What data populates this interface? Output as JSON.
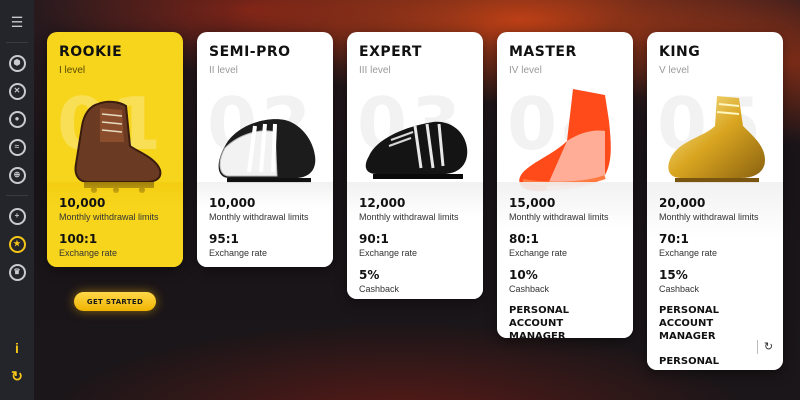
{
  "sidebar": {
    "items": [
      {
        "icon": "menu-icon"
      },
      {
        "icon": "soccer-ball-icon"
      },
      {
        "icon": "basketball-icon"
      },
      {
        "icon": "film-reel-icon"
      },
      {
        "icon": "wifi-icon"
      },
      {
        "icon": "globe-icon"
      },
      {
        "icon": "crosshair-icon"
      },
      {
        "icon": "loyalty-star-icon",
        "active": true
      },
      {
        "icon": "trophy-icon"
      }
    ],
    "bottom": [
      {
        "icon": "info-icon",
        "glyph": "i"
      },
      {
        "icon": "support-icon",
        "glyph": "↻"
      }
    ]
  },
  "colors": {
    "accent": "#f5c518",
    "card_yellow": "#f7d51d"
  },
  "levels": [
    {
      "title": "ROOKIE",
      "level": "I level",
      "big": "01",
      "limit": "10,000",
      "limit_label": "Monthly withdrawal limits",
      "rate": "100:1",
      "rate_label": "Exchange rate",
      "boot": "brown-vintage-boot-icon"
    },
    {
      "title": "SEMI-PRO",
      "level": "II level",
      "big": "02",
      "limit": "10,000",
      "limit_label": "Monthly withdrawal limits",
      "rate": "95:1",
      "rate_label": "Exchange rate",
      "boot": "black-white-boot-icon"
    },
    {
      "title": "EXPERT",
      "level": "III level",
      "big": "03",
      "limit": "12,000",
      "limit_label": "Monthly withdrawal limits",
      "rate": "90:1",
      "rate_label": "Exchange rate",
      "cashback": "5%",
      "cashback_label": "Cashback",
      "boot": "black-classic-boot-icon"
    },
    {
      "title": "MASTER",
      "level": "IV level",
      "big": "04",
      "limit": "15,000",
      "limit_label": "Monthly withdrawal limits",
      "rate": "80:1",
      "rate_label": "Exchange rate",
      "cashback": "10%",
      "cashback_label": "Cashback",
      "perk1": "PERSONAL ACCOUNT MANAGER",
      "boot": "orange-modern-boot-icon"
    },
    {
      "title": "KING",
      "level": "V level",
      "big": "05",
      "limit": "20,000",
      "limit_label": "Monthly withdrawal limits",
      "rate": "70:1",
      "rate_label": "Exchange rate",
      "cashback": "15%",
      "cashback_label": "Cashback",
      "perk1": "PERSONAL ACCOUNT MANAGER",
      "perk2": "PERSONAL PROMOTION",
      "boot": "golden-boot-icon"
    }
  ],
  "cta": {
    "label": "GET STARTED"
  },
  "refresh_icon": "refresh-icon"
}
